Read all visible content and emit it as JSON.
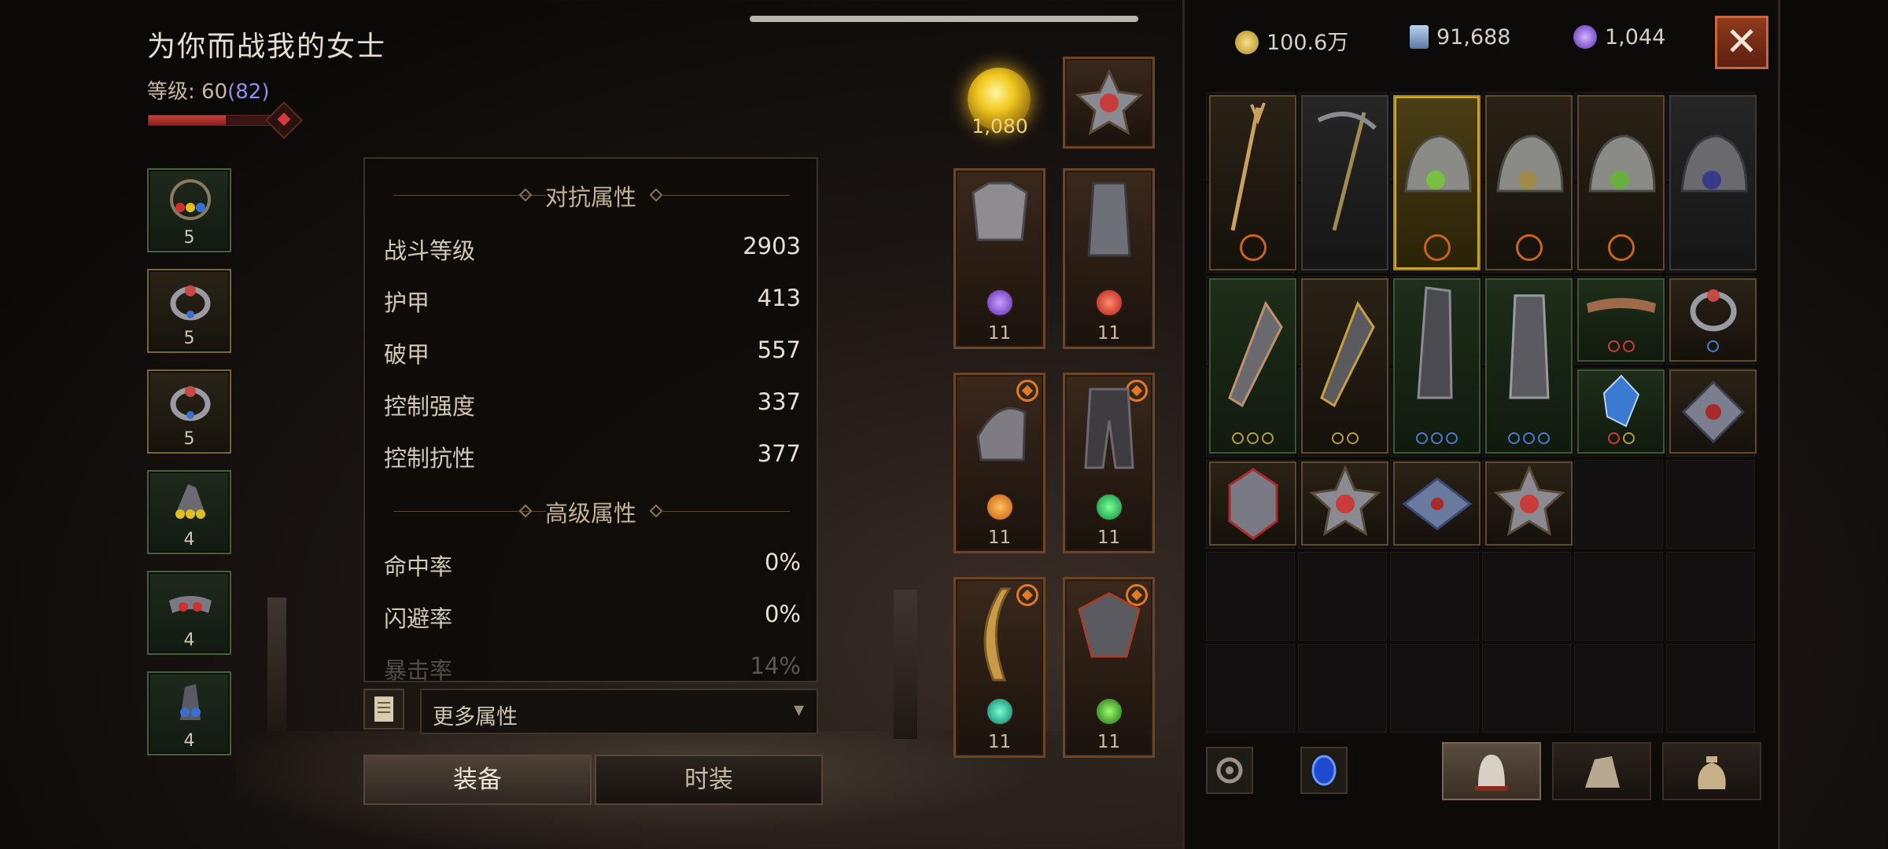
{
  "character": {
    "name": "为你而战我的女士",
    "level_label": "等级: ",
    "level": "60",
    "paragon": "(82)",
    "xp_fraction": 0.62
  },
  "left_slots": [
    {
      "count": "5",
      "gems": [
        "red",
        "yellow",
        "blue"
      ]
    },
    {
      "count": "5",
      "gems": [
        "blue"
      ]
    },
    {
      "count": "5",
      "gems": [
        "blue"
      ]
    },
    {
      "count": "4",
      "gems": [
        "yellow",
        "yellow",
        "yellow"
      ]
    },
    {
      "count": "4",
      "gems": [
        "red",
        "red"
      ]
    },
    {
      "count": "4",
      "gems": [
        "blue",
        "blue"
      ]
    }
  ],
  "stats": {
    "section1_title": "对抗属性",
    "section2_title": "高级属性",
    "combat": [
      {
        "label": "战斗等级",
        "value": "2903"
      },
      {
        "label": "护甲",
        "value": "413"
      },
      {
        "label": "破甲",
        "value": "557"
      },
      {
        "label": "控制强度",
        "value": "337"
      },
      {
        "label": "控制抗性",
        "value": "377"
      }
    ],
    "advanced": [
      {
        "label": "命中率",
        "value": "0%"
      },
      {
        "label": "闪避率",
        "value": "0%"
      },
      {
        "label": "暴击率",
        "value": "14%"
      }
    ],
    "more_label": "更多属性",
    "more_caret": "▾"
  },
  "tabs": {
    "equip": "装备",
    "fashion": "时装"
  },
  "orb": {
    "count": "1,080"
  },
  "equipment": {
    "levels": [
      "11",
      "11",
      "11",
      "11",
      "11",
      "11"
    ]
  },
  "currency": {
    "gold": "100.6万",
    "platinum": "91,688",
    "orbs": "1,044"
  },
  "close_label": "✕",
  "colors": {
    "accent_gold": "#d0a828",
    "legendary_orange": "#e07a24",
    "set_green": "#3a5632",
    "close_red": "#8e3a1c"
  }
}
